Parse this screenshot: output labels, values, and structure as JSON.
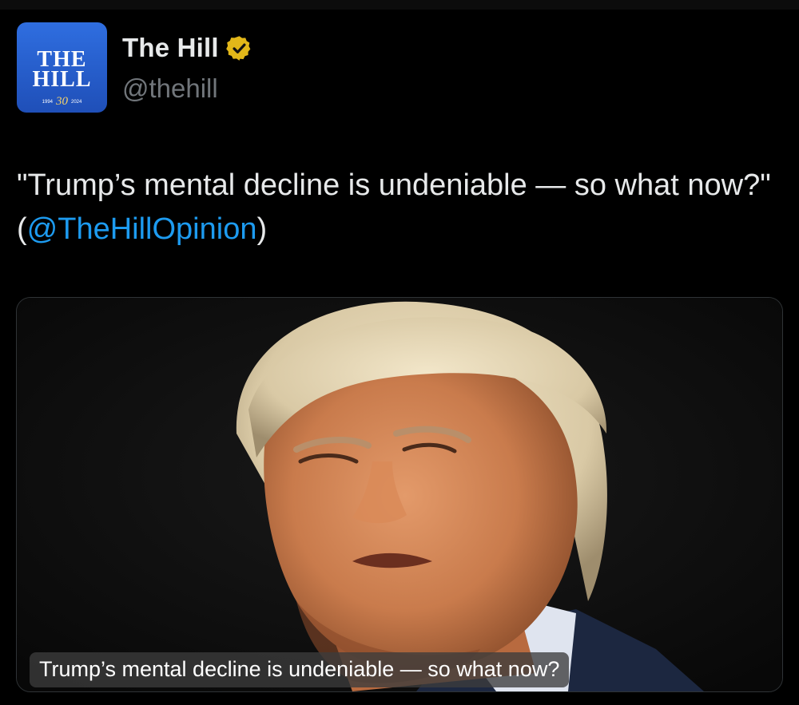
{
  "account": {
    "display_name": "The Hill",
    "handle": "@thehill",
    "avatar_alt": "The Hill logo",
    "avatar_logo_line1": "THE",
    "avatar_logo_line2": "HILL",
    "avatar_year_start": "1994",
    "avatar_anniversary": "30",
    "avatar_year_end": "2024",
    "verified_badge": "gold-verified-checkmark-icon"
  },
  "tweet": {
    "text_before_mention": "\"Trump’s mental decline is undeniable — so what now?\" (",
    "mention": "@TheHillOpinion",
    "text_after_mention": ")"
  },
  "media_card": {
    "caption": "Trump’s mental decline is undeniable — so what now?",
    "image_subject": "photo-portrait"
  },
  "colors": {
    "background": "#000000",
    "text_primary": "#e7e9ea",
    "text_secondary": "#71767b",
    "link": "#1d9bf0",
    "verified_gold": "#e2b719",
    "avatar_blue": "#2a63d6"
  }
}
